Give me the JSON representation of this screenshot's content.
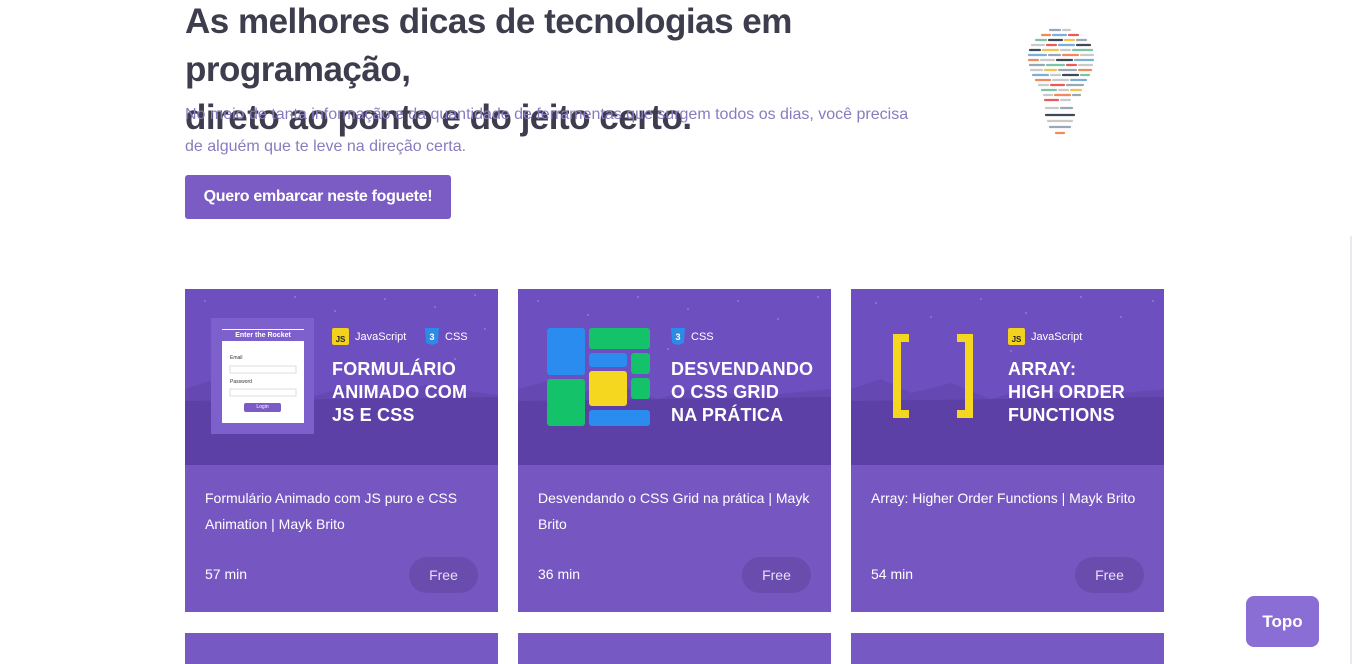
{
  "hero": {
    "title_line1": "As melhores dicas de tecnologias em programação,",
    "title_line2": "direto ao ponto e do jeito certo.",
    "description_line1": "No meio de tanta informação e da quantidade de ferramentas que surgem todos os dias, você precisa",
    "description_line2": "de alguém que te leve na direção certa.",
    "cta_label": "Quero embarcar neste foguete!"
  },
  "cards": [
    {
      "tags": [
        "JavaScript",
        "CSS"
      ],
      "thumb_lines": [
        "FORMULÁRIO",
        "ANIMADO COM",
        "JS E CSS"
      ],
      "mock_form": {
        "title": "Enter the Rocket",
        "email_label": "Email",
        "password_label": "Password",
        "button": "Login"
      },
      "title": "Formulário Animado com JS puro e CSS Animation | Mayk Brito",
      "duration": "57 min",
      "price": "Free"
    },
    {
      "tags": [
        "CSS"
      ],
      "thumb_lines": [
        "DESVENDANDO",
        "O CSS GRID",
        "NA PRÁTICA"
      ],
      "title": "Desvendando o CSS Grid na prática | Mayk Brito",
      "duration": "36 min",
      "price": "Free"
    },
    {
      "tags": [
        "JavaScript"
      ],
      "thumb_lines": [
        "ARRAY:",
        "HIGH ORDER",
        "FUNCTIONS"
      ],
      "title": "Array: Higher Order Functions | Mayk Brito",
      "duration": "54 min",
      "price": "Free"
    }
  ],
  "tag_icons": {
    "js": "JS",
    "css": "3"
  },
  "topo_label": "Topo",
  "colors": {
    "accent": "#7a5cc4",
    "title": "#3d3d4e",
    "description": "#8a7bbf"
  }
}
